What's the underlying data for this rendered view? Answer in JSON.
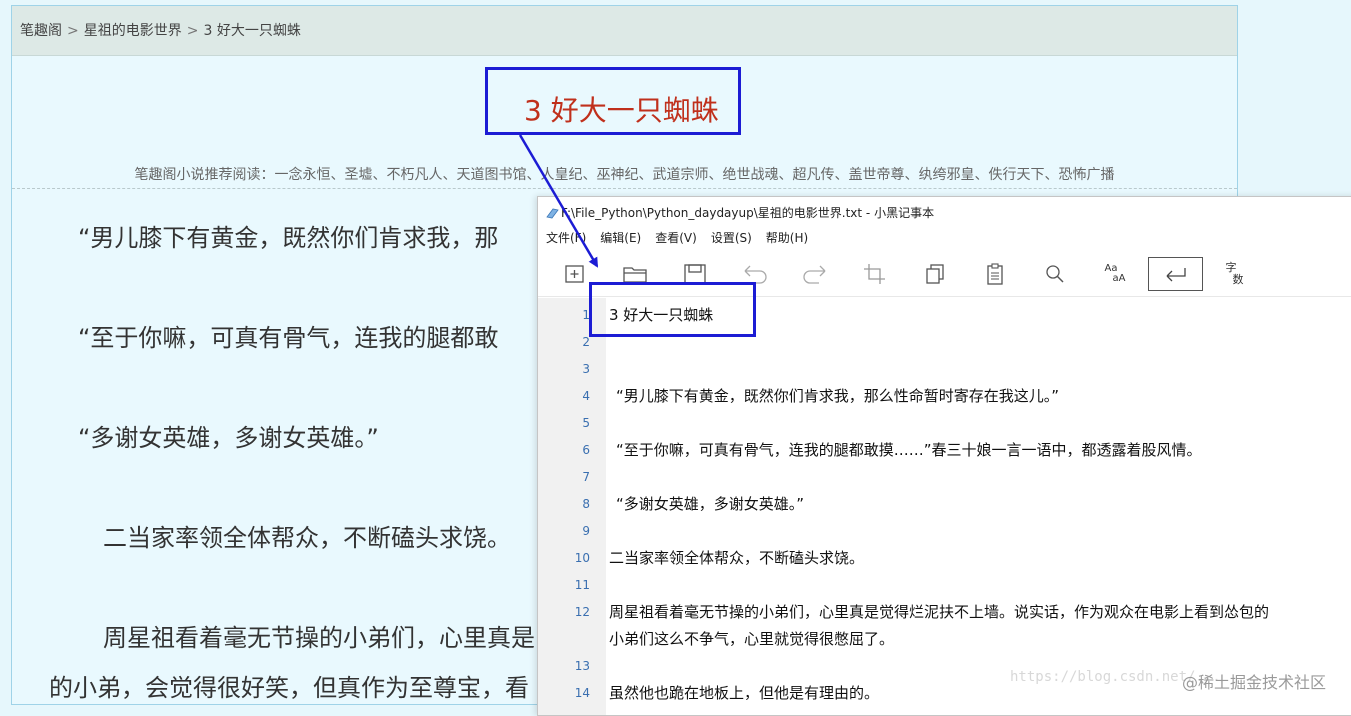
{
  "breadcrumb": {
    "items": [
      "笔趣阁",
      "星祖的电影世界",
      "3 好大一只蜘蛛"
    ],
    "separator": ">"
  },
  "webpage": {
    "chapter_title": "3 好大一只蜘蛛",
    "recommend": "笔趣阁小说推荐阅读：一念永恒、圣墟、不朽凡人、天道图书馆、人皇纪、巫神纪、武道宗师、绝世战魂、超凡传、盖世帝尊、纨绔邪皇、佚行天下、恐怖广播",
    "paragraphs": [
      "“男儿膝下有黄金，既然你们肯求我，那",
      "“至于你嘛，可真有骨气，连我的腿都敢",
      "“多谢女英雄，多谢女英雄。”",
      "二当家率领全体帮众，不断磕头求饶。",
      "周星祖看着毫无节操的小弟们，心里真是",
      "的小弟，会觉得很好笑，但真作为至尊宝，看"
    ]
  },
  "annotation": {
    "title_box_text": "3 好大一只蜘蛛",
    "color": "#1c1cd4"
  },
  "notepad": {
    "title": "F:\\File_Python\\Python_daydayup\\星祖的电影世界.txt - 小黑记事本",
    "menu": [
      "文件(F)",
      "编辑(E)",
      "查看(V)",
      "设置(S)",
      "帮助(H)"
    ],
    "toolbar": {
      "icons": [
        "new-file-icon",
        "open-folder-icon",
        "save-icon",
        "undo-icon",
        "redo-icon",
        "crop-icon",
        "copy-icon",
        "paste-icon",
        "search-icon",
        "font-case-icon",
        "word-wrap-icon",
        "word-count-icon"
      ],
      "case_label_top": "Aa",
      "case_label_bottom": "aA",
      "word_count_top": "字",
      "word_count_bottom": "数"
    },
    "line_numbers": [
      "1",
      "2",
      "3",
      "4",
      "5",
      "6",
      "7",
      "8",
      "9",
      "10",
      "11",
      "12",
      "13",
      "14"
    ],
    "lines": {
      "l1": "3 好大一只蜘蛛",
      "l4": "“男儿膝下有黄金，既然你们肯求我，那么性命暂时寄存在我这儿。”",
      "l6": "“至于你嘛，可真有骨气，连我的腿都敢摸……”春三十娘一言一语中，都透露着股风情。",
      "l8": "“多谢女英雄，多谢女英雄。”",
      "l10": "二当家率领全体帮众，不断磕头求饶。",
      "l12a": "周星祖看着毫无节操的小弟们，心里真是觉得烂泥扶不上墙。说实话，作为观众在电影上看到怂包的",
      "l12b": "小弟们这么不争气，心里就觉得很憋屈了。",
      "l14": "虽然他也跪在地板上，但他是有理由的。"
    }
  },
  "watermark": {
    "url": "https://blog.csdn.net/...",
    "site": "@稀土掘金技术社区"
  }
}
